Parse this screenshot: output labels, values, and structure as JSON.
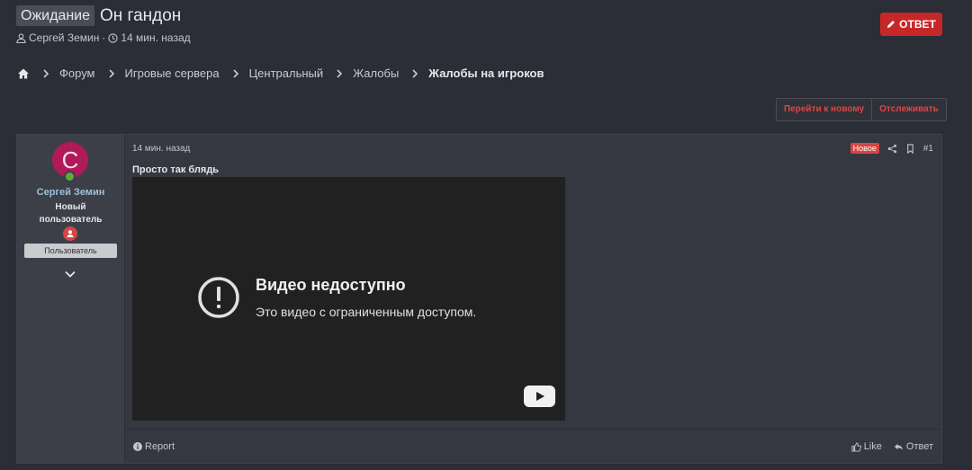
{
  "thread": {
    "prefix": "Ожидание",
    "title": "Он гандон",
    "author": "Сергей Земин",
    "separator": "·",
    "time": "14 мин. назад",
    "reply_button": "ОТВЕТ"
  },
  "breadcrumb": {
    "items": [
      "Форум",
      "Игровые сервера",
      "Центральный",
      "Жалобы"
    ],
    "current": "Жалобы на игроков"
  },
  "actions": {
    "goto_new": "Перейти к новому",
    "watch": "Отслеживать"
  },
  "post": {
    "user": {
      "avatar_letter": "С",
      "name": "Сергей Земин",
      "title": "Новый пользователь",
      "banner": "Пользователь"
    },
    "date": "14 мин. назад",
    "new_badge": "Новое",
    "number": "#1",
    "text": "Просто так блядь",
    "video": {
      "title": "Видео недоступно",
      "subtitle": "Это видео с ограниченным доступом."
    },
    "footer": {
      "report": "Report",
      "like": "Like",
      "reply": "Ответ"
    }
  },
  "colors": {
    "accent": "#c62828",
    "avatar_bg": "#b0195a",
    "online": "#5fa83a",
    "username": "#9ebfd9"
  }
}
